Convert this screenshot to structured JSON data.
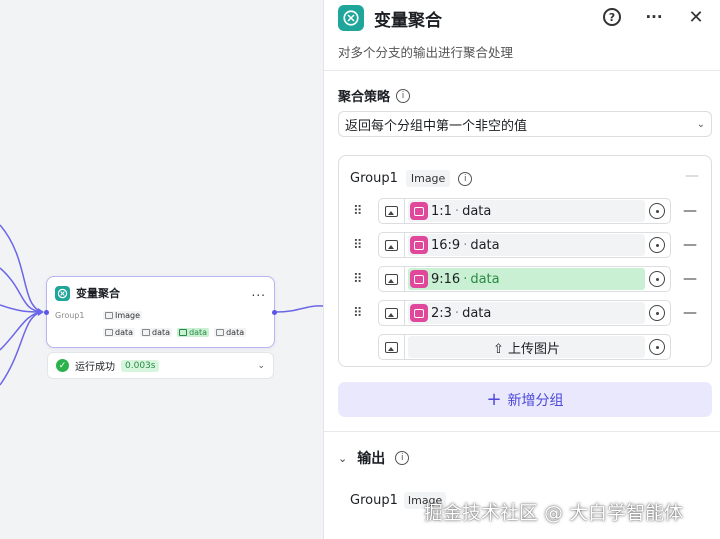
{
  "canvas": {
    "node": {
      "title": "变量聚合",
      "more": "...",
      "group_label": "Group1",
      "group_type": "Image",
      "datas": [
        "data",
        "data",
        "data",
        "data"
      ],
      "highlight_index": 2
    },
    "status": {
      "text": "运行成功",
      "time": "0.003s"
    }
  },
  "panel": {
    "title": "变量聚合",
    "description": "对多个分支的输出进行聚合处理",
    "strategy_label": "聚合策略",
    "strategy_value": "返回每个分组中第一个非空的值",
    "group": {
      "name": "Group1",
      "type": "Image",
      "collapse": "—",
      "variables": [
        {
          "node": "1:1",
          "sep": "·",
          "field": "data"
        },
        {
          "node": "16:9",
          "sep": "·",
          "field": "data"
        },
        {
          "node": "9:16",
          "sep": "·",
          "field": "data"
        },
        {
          "node": "2:3",
          "sep": "·",
          "field": "data"
        }
      ],
      "upload_label": "上传图片"
    },
    "add_group_label": "新增分组",
    "output": {
      "label": "输出",
      "name": "Group1",
      "type": "Image"
    }
  },
  "watermark": "掘金技术社区 @ 大白学智能体",
  "colors": {
    "accent": "#4d48d9",
    "brand": "#1fa59a",
    "success": "#2bb24c",
    "ref_icon": "#e0499b"
  }
}
